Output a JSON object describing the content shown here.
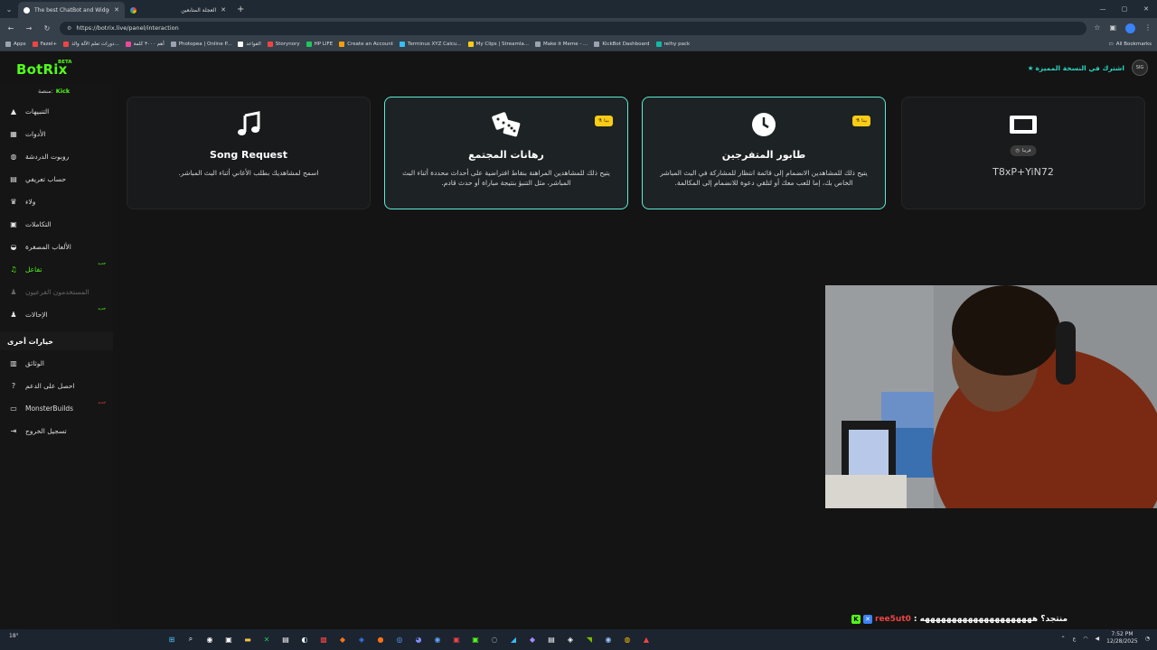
{
  "browser": {
    "tabs": [
      {
        "title": "The best ChatBot and Widgets",
        "active": true
      },
      {
        "title": "العجلة المتابعين",
        "active": false
      }
    ],
    "url": "https://botrix.live/panel/interaction",
    "bookmarks": [
      "Apps",
      "Fazel+",
      "دورات تعلم الآلة والذ...",
      "أهم ٣٠٠٠ كلمة",
      "Photopea | Online P...",
      "القواعد",
      "Storynory",
      "HP LIFE",
      "Create an Account",
      "Terminus XYZ Calcu...",
      "My Clips | Streamla...",
      "Make it Meme - ...",
      "KickBot Dashboard",
      "relhy pack"
    ],
    "all_bookmarks": "All Bookmarks"
  },
  "header": {
    "logo": "BotRix",
    "logo_badge": "BETA",
    "premium_cta": "اشترك في النسخة المميزة",
    "avatar_text": "SIG"
  },
  "sidebar": {
    "platform_label": "منصة:",
    "platform_value": "Kick",
    "items": [
      {
        "label": "التنبيهات",
        "icon": "alert-icon"
      },
      {
        "label": "الأدوات",
        "icon": "grid-icon"
      },
      {
        "label": "روبوت الدردشة",
        "icon": "robot-icon"
      },
      {
        "label": "حساب تعريفي",
        "icon": "user-card-icon"
      },
      {
        "label": "ولاء",
        "icon": "trophy-icon"
      },
      {
        "label": "التكاملات",
        "icon": "plug-icon"
      },
      {
        "label": "الألعاب المصغرة",
        "icon": "gamepad-icon"
      },
      {
        "label": "تفاعل",
        "icon": "music-icon",
        "badge": "جديد"
      },
      {
        "label": "المستخدمون الفرعيون",
        "icon": "users-icon"
      },
      {
        "label": "الإحالات",
        "icon": "users-icon",
        "badge": "جديد"
      }
    ],
    "other_title": "خيارات أخرى",
    "other_items": [
      {
        "label": "الوثائق",
        "icon": "doc-icon"
      },
      {
        "label": "احصل على الدعم",
        "icon": "help-icon"
      },
      {
        "label": "MonsterBuilds",
        "icon": "laptop-icon",
        "badge": "جديد"
      },
      {
        "label": "تسجيل الخروج",
        "icon": "logout-icon"
      }
    ]
  },
  "cards": [
    {
      "title": "Song Request",
      "description": "اسمح لمشاهديك بطلب الأغاني أثناء البث المباشر.",
      "icon": "music-note-icon",
      "highlight": false
    },
    {
      "title": "رهانات المجتمع",
      "description": "يتيح ذلك للمشاهدين المراهنة بنقاط افتراضية على أحداث محددة أثناء البث المباشر، مثل التنبؤ بنتيجة مباراة أو حدث قادم.",
      "icon": "dice-icon",
      "badge": "بيتا",
      "highlight": true
    },
    {
      "title": "طابور المتفرجين",
      "description": "يتيح ذلك للمشاهدين الانضمام إلى قائمة انتظار للمشاركة في البث المباشر الخاص بك، إما للعب معك أو لتلقي دعوة للانضمام إلى المكالمة.",
      "icon": "clock-icon",
      "badge": "بيتا",
      "highlight": true
    },
    {
      "title": "T8xP+YiN72",
      "icon": "ticket-icon",
      "soon": "قريبا",
      "highlight": false
    }
  ],
  "chat": {
    "message": "منتجد؟ هههههههههههههههههههههه :",
    "user": "ree5ut0"
  },
  "taskbar": {
    "weather": "18°",
    "time": "7:52 PM",
    "date": "12/28/2025",
    "lang": "ع"
  },
  "colors": {
    "brand": "#53fc18",
    "accent": "#5eead4",
    "beta": "#facc15"
  }
}
